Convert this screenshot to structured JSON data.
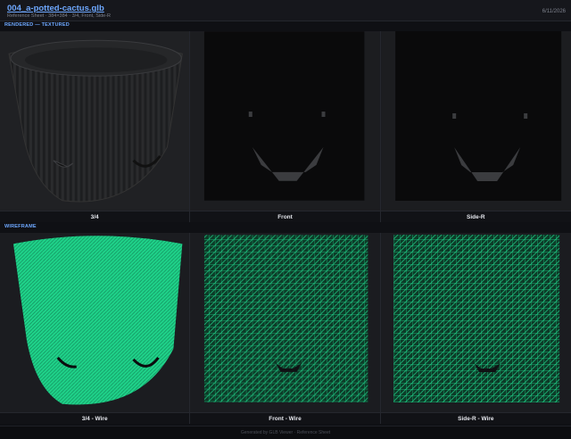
{
  "header": {
    "title": "004_a-potted-cactus.glb",
    "subtitle": "Reference Sheet · 384×384 · 3/4, Front, Side-R",
    "date": "6/11/2026"
  },
  "sections": {
    "rendered_label": "RENDERED — TEXTURED",
    "wireframe_label": "WIREFRAME"
  },
  "rendered_views": [
    {
      "label": "3/4"
    },
    {
      "label": "Front"
    },
    {
      "label": "Side-R"
    }
  ],
  "wireframe_views": [
    {
      "label": "3/4 - Wire"
    },
    {
      "label": "Front - Wire"
    },
    {
      "label": "Side-R - Wire"
    }
  ],
  "footer": {
    "text": "Generated by GLB Viewer · Reference Sheet"
  },
  "colors": {
    "accent": "#6ea8ff",
    "wire": "#1fd38a",
    "panel_bg": "#1b1c20"
  }
}
